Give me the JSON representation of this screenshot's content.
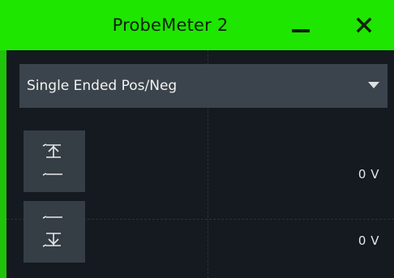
{
  "window": {
    "title": "ProbeMeter 2",
    "accent_color": "#1ee600"
  },
  "titlebar": {
    "minimize_icon": "minimize-icon",
    "close_icon": "close-icon"
  },
  "mode_select": {
    "selected": "Single Ended Pos/Neg",
    "arrow_icon": "caret-down-icon"
  },
  "channels": [
    {
      "icon": "probe-positive-icon",
      "value": "0 V"
    },
    {
      "icon": "probe-negative-icon",
      "value": "0 V"
    }
  ]
}
